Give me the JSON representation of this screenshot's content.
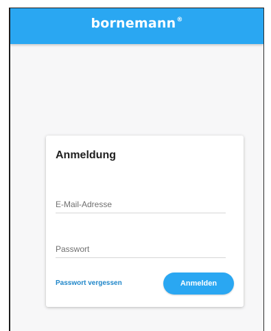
{
  "header": {
    "brand": "bornemann",
    "brand_mark": "®"
  },
  "login_card": {
    "title": "Anmeldung",
    "email_placeholder": "E-Mail-Adresse",
    "password_placeholder": "Passwort",
    "forgot_password_label": "Passwort vergessen",
    "submit_label": "Anmelden"
  },
  "colors": {
    "brand_blue": "#2aa7f2",
    "link_blue": "#1f86c9",
    "background": "#f7f7f8"
  }
}
